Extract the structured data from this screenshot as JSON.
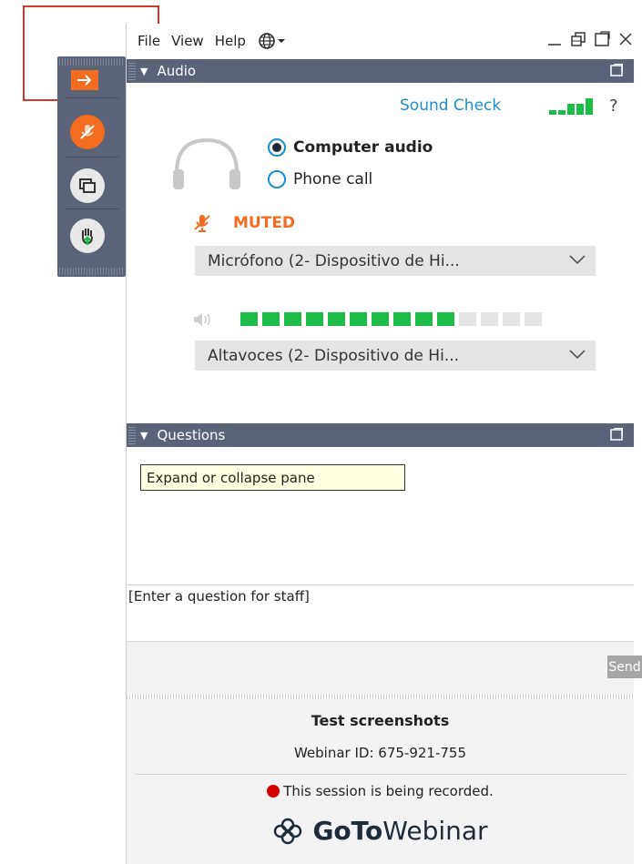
{
  "menubar": {
    "items": [
      "File",
      "View",
      "Help"
    ]
  },
  "audio": {
    "header": "Audio",
    "sound_check": "Sound Check",
    "help": "?",
    "options": {
      "computer_audio": "Computer audio",
      "phone_call": "Phone call",
      "selected": "computer_audio"
    },
    "muted_label": "MUTED",
    "microphone_select": "Micrófono (2- Dispositivo de Hi...",
    "speaker_select": "Altavoces (2- Dispositivo de Hi...",
    "speaker_level": {
      "active": 10,
      "total": 14
    }
  },
  "questions": {
    "header": "Questions",
    "tooltip": "Expand or collapse pane",
    "input_placeholder": "[Enter a question for staff]",
    "send_label": "Send"
  },
  "footer": {
    "title": "Test screenshots",
    "webinar_id": "Webinar ID: 675-921-755",
    "recording_notice": "This session is being recorded.",
    "brand_bold": "GoTo",
    "brand_rest": "Webinar"
  },
  "colors": {
    "accent_orange": "#f36c21",
    "link_blue": "#1a8fd0",
    "level_green": "#1bbd47",
    "header_slate": "#5b6378",
    "record_red": "#d40000"
  }
}
